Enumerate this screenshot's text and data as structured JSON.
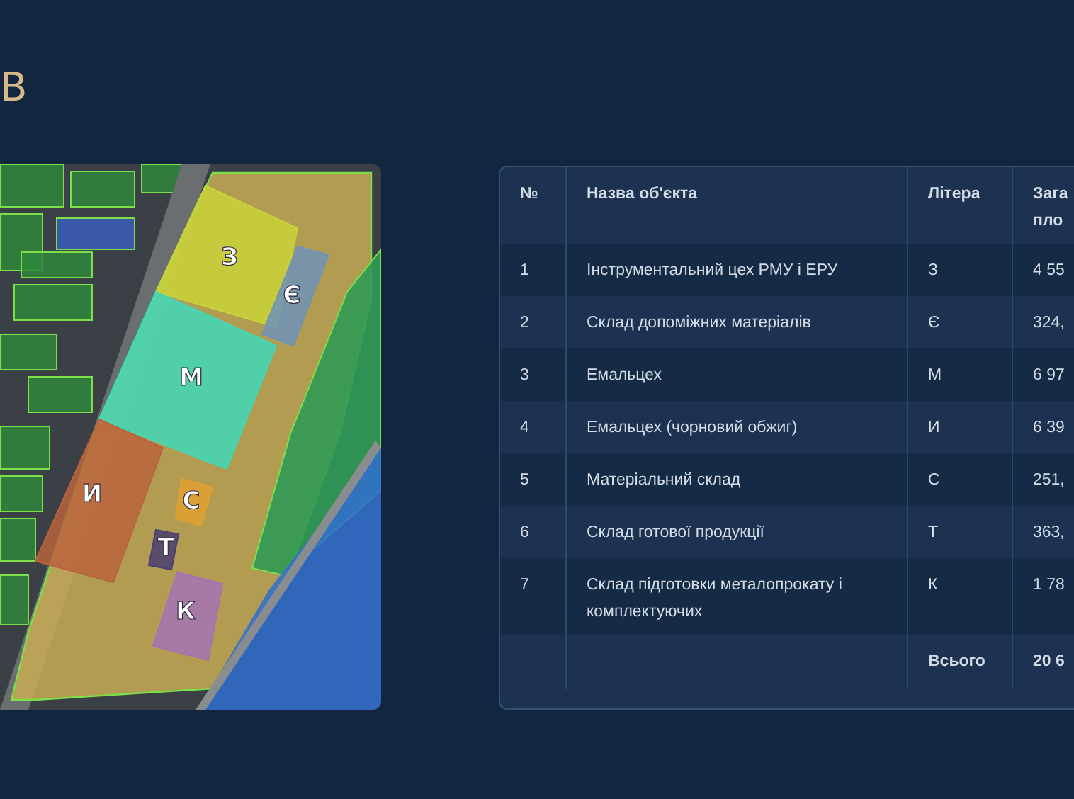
{
  "heading": "В",
  "map": {
    "plots": [
      {
        "label": "З",
        "color": "#c9d23a"
      },
      {
        "label": "Є",
        "color": "#6f93b8"
      },
      {
        "label": "М",
        "color": "#3fd8b8"
      },
      {
        "label": "И",
        "color": "#b8643c"
      },
      {
        "label": "С",
        "color": "#e0a030"
      },
      {
        "label": "Т",
        "color": "#4a3f70"
      },
      {
        "label": "К",
        "color": "#a573b5"
      }
    ]
  },
  "table": {
    "columns": [
      "№",
      "Назва об'єкта",
      "Літера",
      "Зага пло"
    ],
    "rows": [
      [
        "1",
        "Інструментальний цех РМУ і ЕРУ",
        "З",
        "4 55"
      ],
      [
        "2",
        "Склад допоміжних матеріалів",
        "Є",
        "324,"
      ],
      [
        "3",
        "Емальцех",
        "М",
        "6 97"
      ],
      [
        "4",
        "Емальцех (чорновий обжиг)",
        "И",
        "6 39"
      ],
      [
        "5",
        "Матеріальний склад",
        "С",
        "251,"
      ],
      [
        "6",
        "Склад готової продукції",
        "Т",
        "363,"
      ],
      [
        "7",
        "Склад підготовки металопрокату і комплектуючих",
        "К",
        "1 78"
      ]
    ],
    "total": {
      "label": "Всього",
      "value": "20 6"
    }
  }
}
